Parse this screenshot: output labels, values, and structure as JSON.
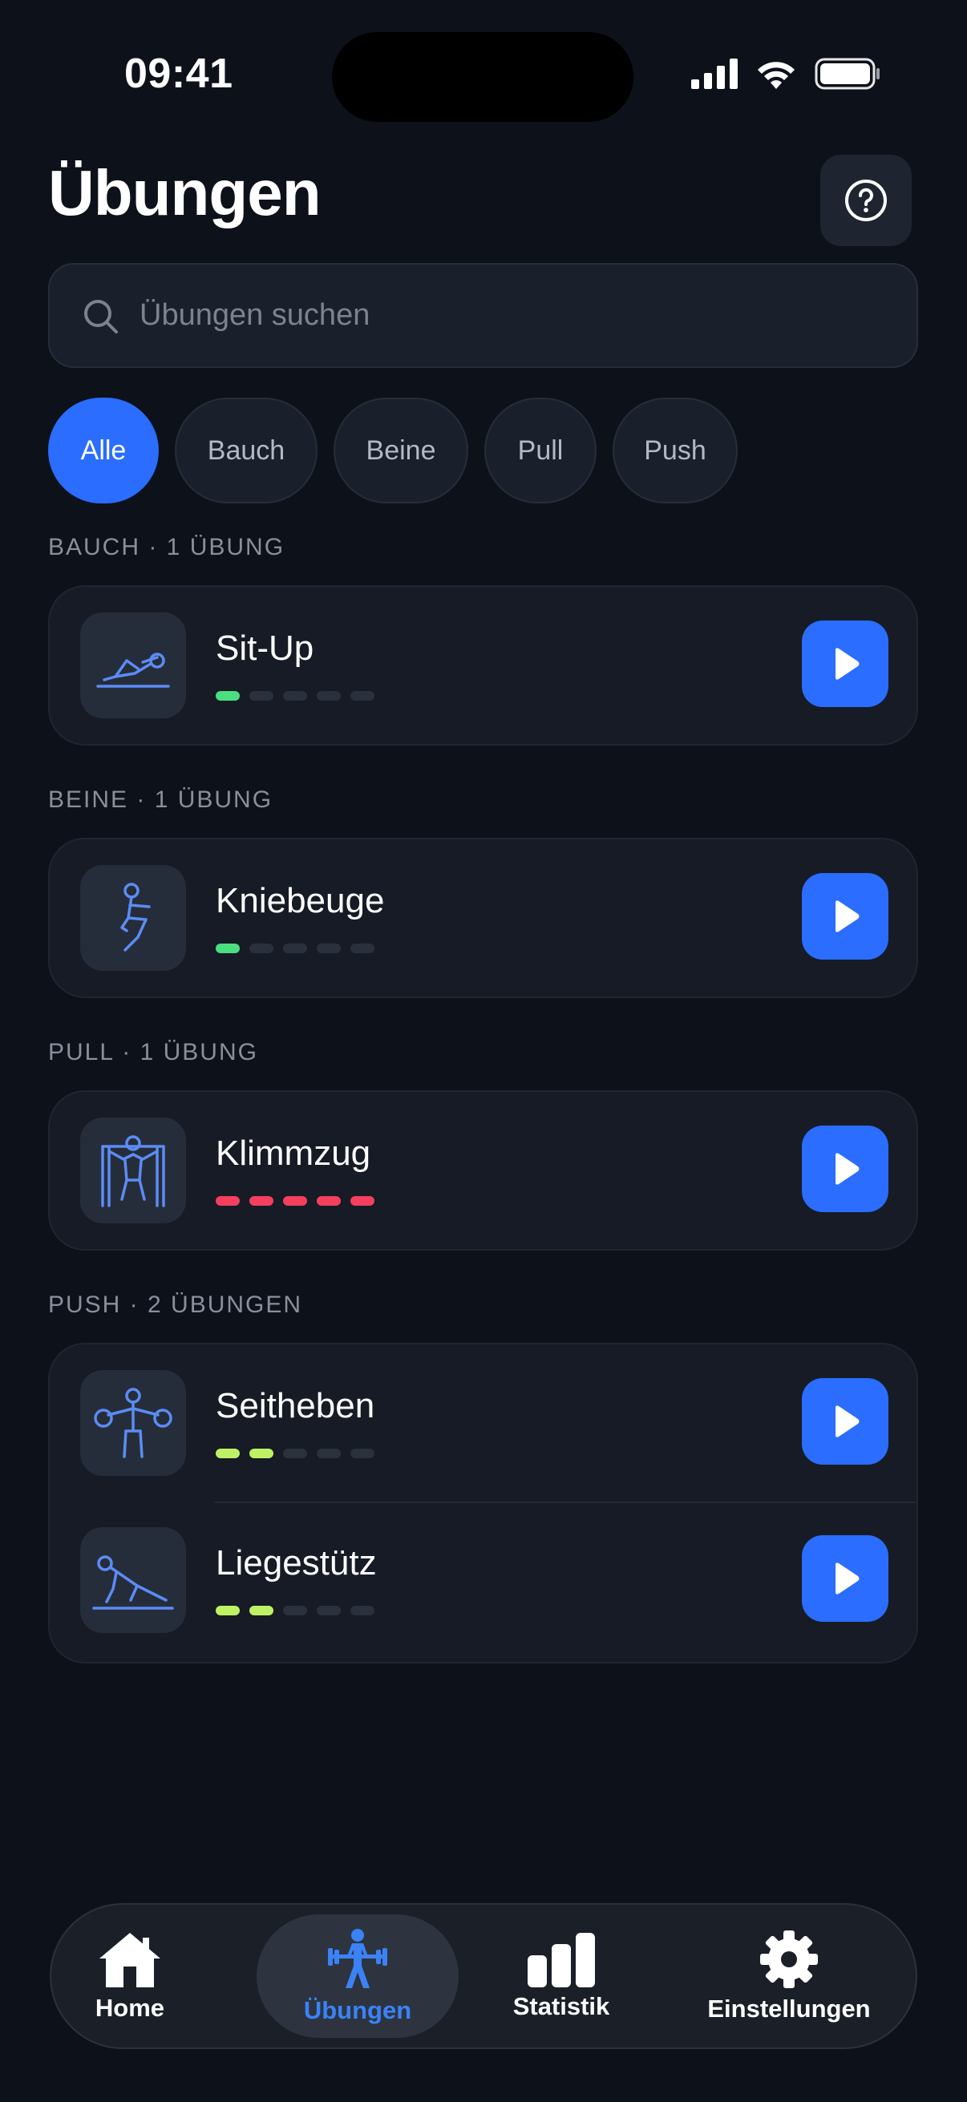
{
  "status_bar": {
    "time": "09:41"
  },
  "header": {
    "title": "Übungen"
  },
  "search": {
    "placeholder": "Übungen suchen"
  },
  "filters": [
    "Alle",
    "Bauch",
    "Beine",
    "Pull",
    "Push"
  ],
  "sections": [
    {
      "label": "BAUCH · 1 ÜBUNG",
      "exercises": [
        {
          "name": "Sit-Up",
          "icon": "situp-icon",
          "level": 1,
          "level_color": "#4ade80"
        }
      ]
    },
    {
      "label": "BEINE · 1 ÜBUNG",
      "exercises": [
        {
          "name": "Kniebeuge",
          "icon": "squat-icon",
          "level": 1,
          "level_color": "#4ade80"
        }
      ]
    },
    {
      "label": "PULL · 1 ÜBUNG",
      "exercises": [
        {
          "name": "Klimmzug",
          "icon": "pullup-icon",
          "level": 5,
          "level_color": "#f43f5e"
        }
      ]
    },
    {
      "label": "PUSH · 2 ÜBUNGEN",
      "exercises": [
        {
          "name": "Seitheben",
          "icon": "lateral-raise-icon",
          "level": 2,
          "level_color": "#bef264"
        },
        {
          "name": "Liegestütz",
          "icon": "pushup-icon",
          "level": 2,
          "level_color": "#bef264"
        }
      ]
    }
  ],
  "tabbar": {
    "home": "Home",
    "exercises": "Übungen",
    "stats": "Statistik",
    "settings": "Einstellungen"
  },
  "colors": {
    "accent": "#2a6dff",
    "active_tab": "#3b82f6",
    "dot_empty": "#2a313c"
  }
}
